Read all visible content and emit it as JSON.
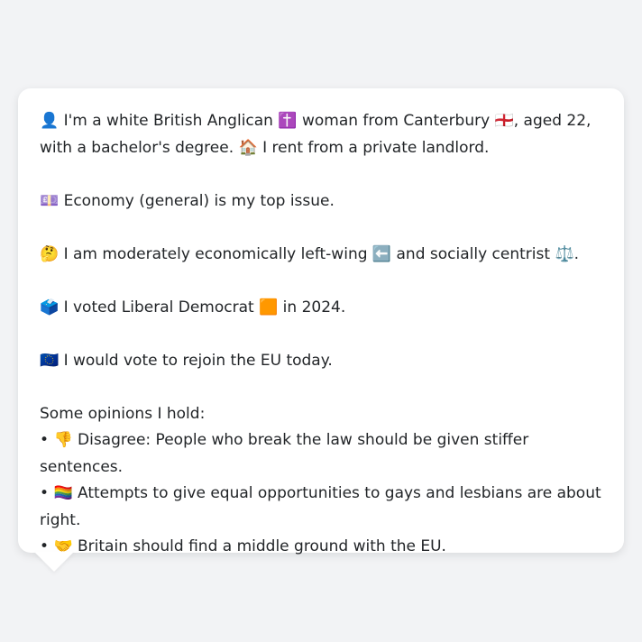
{
  "profile": {
    "intro_emoji": "👤",
    "intro_part1": " I'm a white British Anglican ",
    "religion_emoji": "✝️",
    "intro_part2": " woman from Canterbury ",
    "flag_emoji": "🏴󠁧󠁢󠁥󠁮󠁧󠁿",
    "intro_part3": ", aged 22, with a bachelor's degree. ",
    "house_emoji": "🏠",
    "intro_part4": " I rent from a private landlord."
  },
  "issue": {
    "emoji": "💷",
    "text": " Economy (general) is my top issue."
  },
  "ideology": {
    "emoji": "🤔",
    "part1": " I am moderately economically left-wing ",
    "left_emoji": "⬅️",
    "part2": " and socially centrist ",
    "scale_emoji": "⚖️",
    "part3": "."
  },
  "vote": {
    "emoji": "🗳️",
    "part1": " I voted Liberal Democrat ",
    "party_emoji": "🟧",
    "part2": " in 2024."
  },
  "eu": {
    "emoji": "🇪🇺",
    "text": " I would vote to rejoin the EU today."
  },
  "opinions": {
    "heading": "Some opinions I hold:",
    "items": [
      {
        "bullet": "• ",
        "emoji": "👎",
        "text": " Disagree: People who break the law should be given stiffer sentences."
      },
      {
        "bullet": "• ",
        "emoji": "🏳️‍🌈",
        "text": " Attempts to give equal opportunities to gays and lesbians are about right."
      },
      {
        "bullet": "• ",
        "emoji": "🤝",
        "text": " Britain should find a middle ground with the EU."
      }
    ]
  }
}
